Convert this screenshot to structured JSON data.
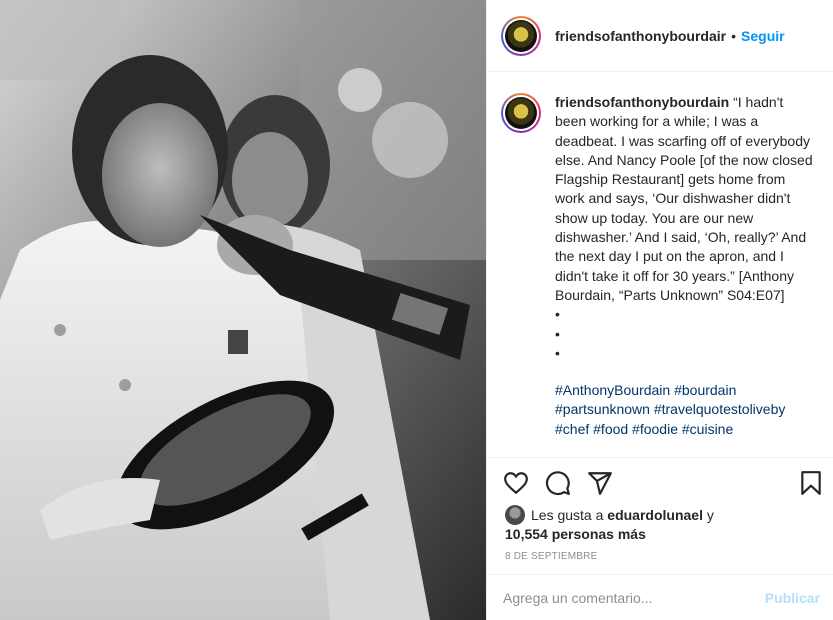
{
  "post": {
    "username": "friendsofanthonybourdair",
    "follow_label": "Seguir",
    "separator": "•"
  },
  "caption": {
    "username": "friendsofanthonybourdain",
    "text": "“I hadn't been working for a while; I was a deadbeat. I was scarfing off of everybody else. And Nancy Poole [of the now closed Flagship Restaurant] gets home from work and says, ‘Our dishwasher didn't show up today. You are our new dishwasher.’ And I said, ‘Oh, really?’ And the next day I put on the apron, and I didn't take it off for 30 years.” [Anthony Bourdain, “Parts Unknown” S04:E07]",
    "bullets": [
      "•",
      "•",
      "•"
    ],
    "hashtags": "#AnthonyBourdain #bourdain #partsunknown #travelquotestoliveby #chef #food #foodie #cuisine"
  },
  "actions": {
    "like_icon": "heart-icon",
    "comment_icon": "comment-icon",
    "share_icon": "paper-plane-icon",
    "save_icon": "bookmark-icon"
  },
  "likes": {
    "prefix": "Les gusta a",
    "liker": "eduardolunael",
    "conjunction": "y",
    "others": "10,554 personas más"
  },
  "date": "8 de septiembre",
  "comment": {
    "placeholder": "Agrega un comentario...",
    "publish_label": "Publicar"
  },
  "colors": {
    "link_blue": "#0095f6",
    "hashtag_blue": "#00376b",
    "muted": "#8e8e8e",
    "publish_disabled": "#b2dffc"
  }
}
